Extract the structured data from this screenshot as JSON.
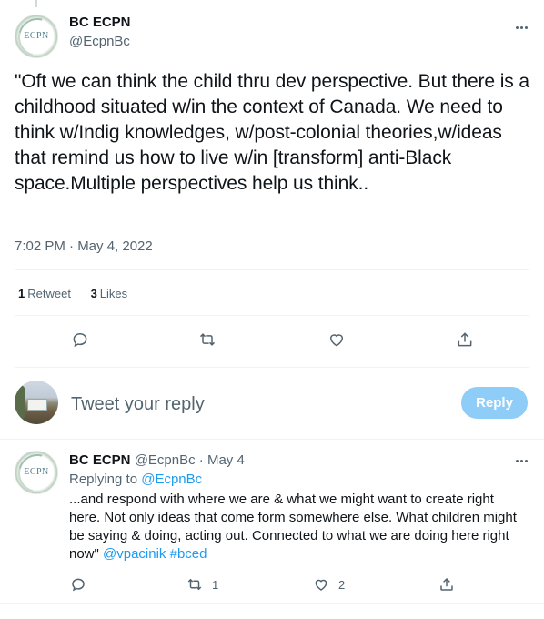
{
  "main_tweet": {
    "display_name": "BC ECPN",
    "handle": "@EcpnBc",
    "avatar_logo_text": "ECPN",
    "text": "\"Oft we can think the child thru dev perspective. But there is a childhood situated w/in the context of Canada. We need to think w/Indig knowledges, w/post-colonial theories,w/ideas that remind us how to live w/in [transform] anti-Black space.Multiple perspectives help us think..",
    "timestamp": "7:02 PM · May 4, 2022",
    "stats": {
      "retweets_count": "1",
      "retweets_label": "Retweet",
      "likes_count": "3",
      "likes_label": "Likes"
    },
    "actions": [
      "reply-icon",
      "retweet-icon",
      "like-icon",
      "share-icon"
    ]
  },
  "reply_composer": {
    "placeholder": "Tweet your reply",
    "button_label": "Reply",
    "button_color": "#8ecdf7"
  },
  "reply_tweet": {
    "display_name": "BC ECPN",
    "handle": "@EcpnBc",
    "separator": "·",
    "date": "May 4",
    "avatar_logo_text": "ECPN",
    "replying_prefix": "Replying to ",
    "replying_to": "@EcpnBc",
    "text": "...and respond with where we are & what we might want to create right here. Not only ideas that come form somewhere else. What children might be saying & doing, acting out. Connected to what we are doing here right now\" ",
    "mentions": "@vpacinik",
    "hashtag": "#bced",
    "retweet_count": "1",
    "like_count": "2"
  },
  "colors": {
    "text_primary": "#0f1419",
    "text_secondary": "#536471",
    "link": "#1d9bf0",
    "divider": "#eff3f4"
  }
}
